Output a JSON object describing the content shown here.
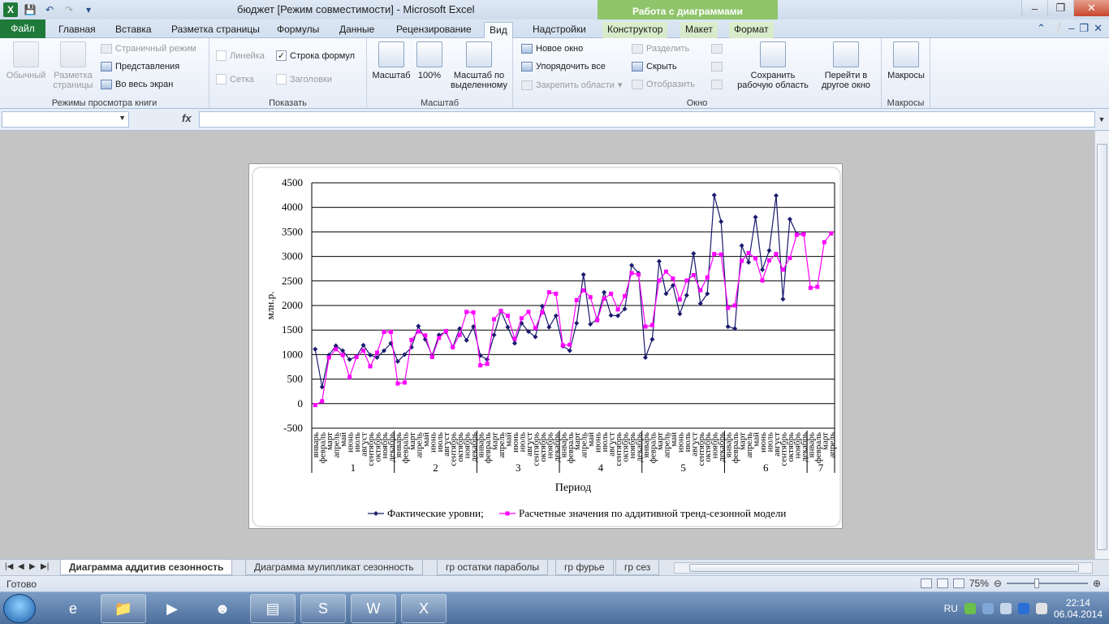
{
  "window": {
    "title": "бюджет  [Режим совместимости]  -  Microsoft Excel",
    "context_band": "Работа с диаграммами"
  },
  "tabs": [
    {
      "label": "Файл"
    },
    {
      "label": "Главная"
    },
    {
      "label": "Вставка"
    },
    {
      "label": "Разметка страницы"
    },
    {
      "label": "Формулы"
    },
    {
      "label": "Данные"
    },
    {
      "label": "Рецензирование"
    },
    {
      "label": "Вид"
    },
    {
      "label": "Надстройки"
    },
    {
      "label": "Конструктор"
    },
    {
      "label": "Макет"
    },
    {
      "label": "Формат"
    }
  ],
  "ribbon": {
    "book_views": {
      "label": "Режимы просмотра книги",
      "normal": "Обычный",
      "page_layout": "Разметка страницы",
      "page_break": "Страничный режим",
      "custom_views": "Представления",
      "full_screen": "Во весь экран"
    },
    "show": {
      "label": "Показать",
      "ruler": "Линейка",
      "formula_bar": "Строка формул",
      "gridlines": "Сетка",
      "headings": "Заголовки"
    },
    "zoom": {
      "label": "Масштаб",
      "zoom": "Масштаб",
      "hundred": "100%",
      "to_selection": "Масштаб по выделенному"
    },
    "window": {
      "label": "Окно",
      "new_window": "Новое окно",
      "arrange_all": "Упорядочить все",
      "freeze": "Закрепить области",
      "split": "Разделить",
      "hide": "Скрыть",
      "unhide": "Отобразить",
      "save_workspace": "Сохранить рабочую область",
      "switch_windows": "Перейти в другое окно"
    },
    "macros": {
      "label": "Макросы",
      "macros": "Макросы"
    }
  },
  "formula_bar": {
    "fx": "fx",
    "value": ""
  },
  "chart_data": {
    "type": "line",
    "ylabel": "млн.р.",
    "xlabel": "Период",
    "ylim": [
      -500,
      4500
    ],
    "yticks": [
      -500,
      0,
      500,
      1000,
      1500,
      2000,
      2500,
      3000,
      3500,
      4000,
      4500
    ],
    "grid": true,
    "legend_position": "bottom",
    "months": [
      "январь",
      "февраль",
      "март",
      "апрель",
      "май",
      "июнь",
      "июль",
      "август",
      "сентябрь",
      "октябрь",
      "ноябрь",
      "декабрь"
    ],
    "periods": [
      "1",
      "2",
      "3",
      "4",
      "5",
      "6",
      "7"
    ],
    "x_count": 76,
    "series": [
      {
        "name": "Фактические уровни;",
        "color": "#1a1a6e",
        "marker": "diamond",
        "values": [
          1110,
          340,
          990,
          1180,
          1080,
          900,
          960,
          1190,
          990,
          940,
          1080,
          1230,
          860,
          1000,
          1150,
          1580,
          1310,
          980,
          1400,
          1460,
          1150,
          1530,
          1290,
          1570,
          980,
          900,
          1400,
          1890,
          1560,
          1230,
          1640,
          1470,
          1360,
          1990,
          1560,
          1790,
          1170,
          1080,
          1640,
          2630,
          1620,
          1720,
          2270,
          1800,
          1790,
          1930,
          2820,
          2660,
          940,
          1310,
          2900,
          2240,
          2410,
          1830,
          2210,
          3060,
          2040,
          2240,
          4250,
          3710,
          1570,
          1530,
          3220,
          2880,
          3800,
          2730,
          3120,
          4240,
          2130,
          3760,
          3460,
          3460,
          null,
          null,
          null,
          null
        ]
      },
      {
        "name": "Расчетные значения по аддитивной тренд-сезонной модели",
        "color": "#ff00ff",
        "marker": "square",
        "values": [
          -30,
          50,
          940,
          1110,
          990,
          540,
          950,
          1080,
          760,
          1040,
          1460,
          1460,
          410,
          430,
          1300,
          1470,
          1390,
          950,
          1340,
          1480,
          1150,
          1400,
          1870,
          1860,
          780,
          810,
          1720,
          1890,
          1790,
          1320,
          1740,
          1870,
          1540,
          1860,
          2270,
          2240,
          1190,
          1200,
          2110,
          2310,
          2170,
          1700,
          2140,
          2240,
          1920,
          2190,
          2660,
          2630,
          1570,
          1600,
          2510,
          2690,
          2550,
          2120,
          2510,
          2620,
          2310,
          2570,
          3050,
          3040,
          1950,
          2000,
          2910,
          3070,
          2960,
          2510,
          2920,
          3050,
          2730,
          2970,
          3440,
          3450,
          2360,
          2380,
          3290,
          3470
        ]
      }
    ]
  },
  "sheet_tabs": [
    {
      "label": "Диаграмма аддитив сезонность"
    },
    {
      "label": "Диаграмма мулипликат сезонность"
    },
    {
      "label": "гр остатки параболы"
    },
    {
      "label": "гр фурье"
    },
    {
      "label": "гр сез"
    }
  ],
  "status": {
    "text": "Готово",
    "zoom": "75%",
    "zoom_fraction": 0.75
  },
  "taskbar": {
    "lang": "RU",
    "time": "22:14",
    "date": "06.04.2014"
  }
}
